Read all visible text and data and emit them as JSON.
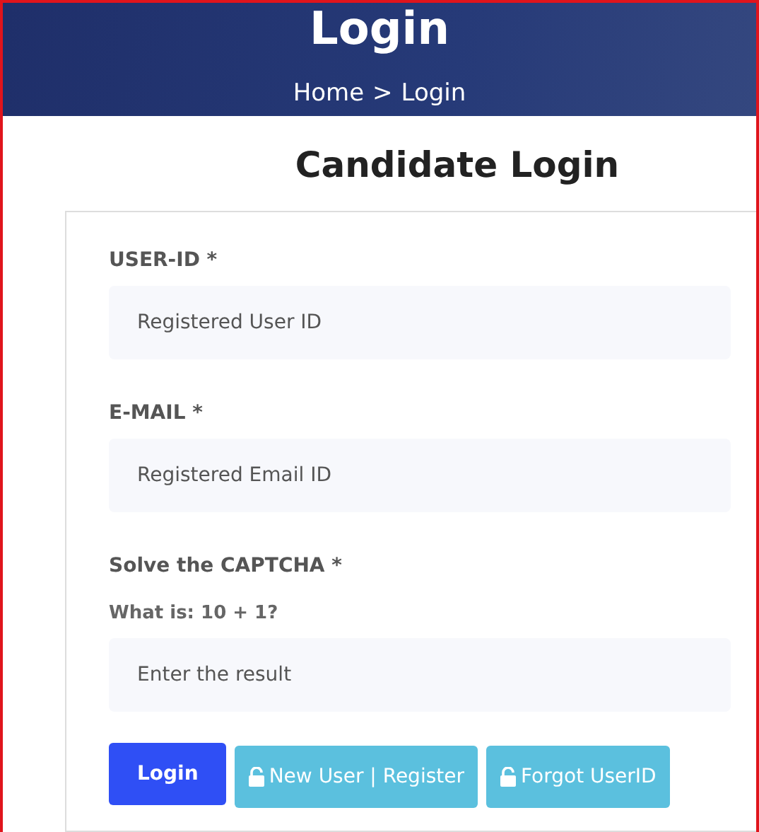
{
  "header": {
    "title": "Login",
    "breadcrumb": [
      {
        "label": "Home"
      },
      {
        "label": "Login"
      }
    ],
    "separator": ">"
  },
  "heading": "Candidate Login",
  "fields": [
    {
      "label": "USER-ID *",
      "placeholder": "Registered User ID"
    },
    {
      "label": "E-MAIL *",
      "placeholder": "Registered Email ID"
    },
    {
      "label": "Solve the CAPTCHA *",
      "question": "What is: 10 + 1?",
      "placeholder": "Enter the result"
    }
  ],
  "buttons": [
    {
      "label": "Login",
      "kind": "primary"
    },
    {
      "label": "New User | Register",
      "kind": "lock"
    },
    {
      "label": "Forgot UserID",
      "kind": "lock"
    }
  ]
}
